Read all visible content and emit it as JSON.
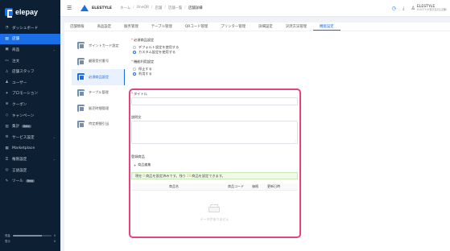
{
  "brand": {
    "logo_text": "elepay"
  },
  "sidebar": {
    "items": [
      {
        "label": "ダッシュボード",
        "icon": "gauge-icon",
        "chevron": false,
        "active": false
      },
      {
        "label": "店舗",
        "icon": "store-icon",
        "chevron": false,
        "active": true
      },
      {
        "label": "商品",
        "icon": "box-icon",
        "chevron": true,
        "active": false
      },
      {
        "label": "注文",
        "icon": "receipt-icon",
        "chevron": false,
        "active": false
      },
      {
        "label": "店舗スタッフ",
        "icon": "staff-icon",
        "chevron": false,
        "active": false
      },
      {
        "label": "ユーザー",
        "icon": "user-icon",
        "chevron": false,
        "active": false
      },
      {
        "label": "プロモーション",
        "icon": "promo-icon",
        "chevron": false,
        "active": false
      },
      {
        "label": "クーポン",
        "icon": "coupon-icon",
        "chevron": false,
        "active": false
      },
      {
        "label": "キャンペーン",
        "icon": "campaign-icon",
        "chevron": false,
        "active": false
      },
      {
        "label": "集計",
        "icon": "chart-icon",
        "chevron": false,
        "active": false,
        "badge": "Beta"
      },
      {
        "label": "サービス設定",
        "icon": "gear-icon",
        "chevron": true,
        "active": false
      },
      {
        "label": "Marketplace",
        "icon": "grid-icon",
        "chevron": false,
        "active": false
      },
      {
        "label": "権限設定",
        "icon": "lock-icon",
        "chevron": true,
        "active": false
      },
      {
        "label": "言語設定",
        "icon": "globe-icon",
        "chevron": false,
        "active": false
      },
      {
        "label": "ツール",
        "icon": "wrench-icon",
        "chevron": false,
        "active": false,
        "badge": "Beta"
      }
    ],
    "usage_label": "残量",
    "usage_fill_fraction": 0.75,
    "usage_sub": "表示",
    "usage_value": "0",
    "usage_value2": "0"
  },
  "header": {
    "shop_name": "ELESTYLE",
    "breadcrumbs": [
      "ホーム",
      "OneQR",
      "店舗",
      "店舗一覧",
      "店舗詳細"
    ],
    "user_name": "ELESTYLE",
    "user_sub": "ELESTYLE株式会社(店舗)"
  },
  "tabs": [
    {
      "label": "店舗情報",
      "active": false
    },
    {
      "label": "商品設定",
      "active": false
    },
    {
      "label": "服务管理",
      "active": false
    },
    {
      "label": "テーブル管理",
      "active": false
    },
    {
      "label": "QRコード管理",
      "active": false
    },
    {
      "label": "プリンター管理",
      "active": false
    },
    {
      "label": "詳細設定",
      "active": false
    },
    {
      "label": "決済方法管理",
      "active": false
    },
    {
      "label": "機能設定",
      "active": true
    }
  ],
  "subnav": [
    {
      "label": "ポイントカード設定",
      "active": false
    },
    {
      "label": "顧客受付番号",
      "active": false
    },
    {
      "label": "必須商品設定",
      "active": true
    },
    {
      "label": "テーブル管理",
      "active": false
    },
    {
      "label": "販売時間管理",
      "active": false
    },
    {
      "label": "特定期間引当",
      "active": false
    }
  ],
  "form": {
    "mode_label": "必須商品設定",
    "mode_options": [
      {
        "label": "デフォルト設定を使用する",
        "selected": false
      },
      {
        "label": "カスタム設定を使用する",
        "selected": true
      }
    ],
    "usage_label": "機能利用設定",
    "usage_options": [
      {
        "label": "停止する",
        "selected": false
      },
      {
        "label": "利用する",
        "selected": true
      }
    ],
    "title_label": "タイトル",
    "title_value": "",
    "desc_label": "説明文",
    "desc_value": "",
    "products_label": "登録商品",
    "edit_button": "商品編集",
    "alert_prefix": "現在",
    "alert_selected_count": "0",
    "alert_middle": "商品を設定済みです。残り",
    "alert_remaining_count": "10",
    "alert_suffix": "商品を設定できます。",
    "table_headers": [
      "商品名",
      "商品コード",
      "価格",
      "更新日時"
    ],
    "empty_text": "データがありません"
  }
}
